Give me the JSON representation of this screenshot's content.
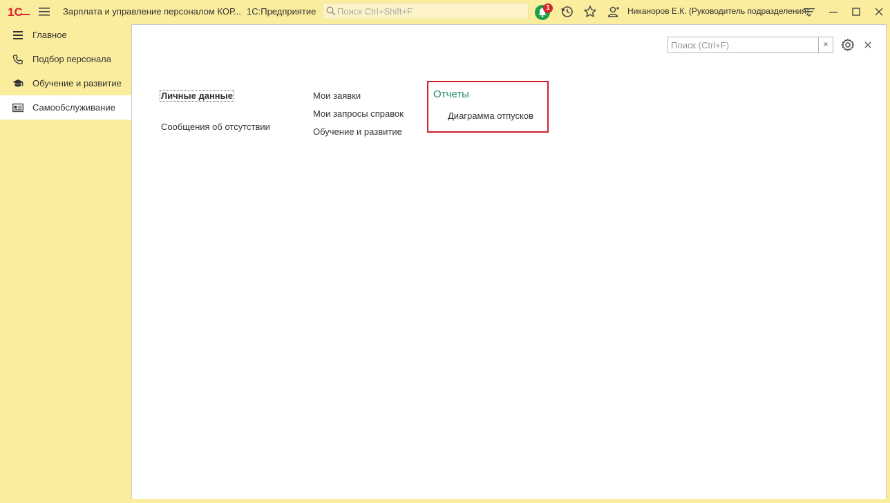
{
  "titlebar": {
    "app_title": "Зарплата и управление персоналом КОР...",
    "platform": "1С:Предприятие",
    "search_placeholder": "Поиск Ctrl+Shift+F",
    "notification_count": "1",
    "user_name": "Никаноров Е.К. (Руководитель подразделения)"
  },
  "sidebar": {
    "items": [
      {
        "label": "Главное",
        "icon": "menu-lines-icon",
        "active": false
      },
      {
        "label": "Подбор персонала",
        "icon": "phone-icon",
        "active": false
      },
      {
        "label": "Обучение и развитие",
        "icon": "graduation-cap-icon",
        "active": false
      },
      {
        "label": "Самообслуживание",
        "icon": "id-card-icon",
        "active": true
      }
    ]
  },
  "panel": {
    "search_placeholder": "Поиск (Ctrl+F)",
    "clear_label": "×",
    "col1": [
      "Личные данные",
      "Сообщения об отсутствии"
    ],
    "col2": [
      "Мои заявки",
      "Мои запросы справок",
      "Обучение и развитие"
    ],
    "reports": {
      "title": "Отчеты",
      "items": [
        "Диаграмма отпусков"
      ]
    }
  },
  "colors": {
    "sidebar_bg": "#fbed9e",
    "accent_green": "#1e8a6e",
    "highlight_red": "#d0202a",
    "bell_green": "#1f9e4c"
  }
}
